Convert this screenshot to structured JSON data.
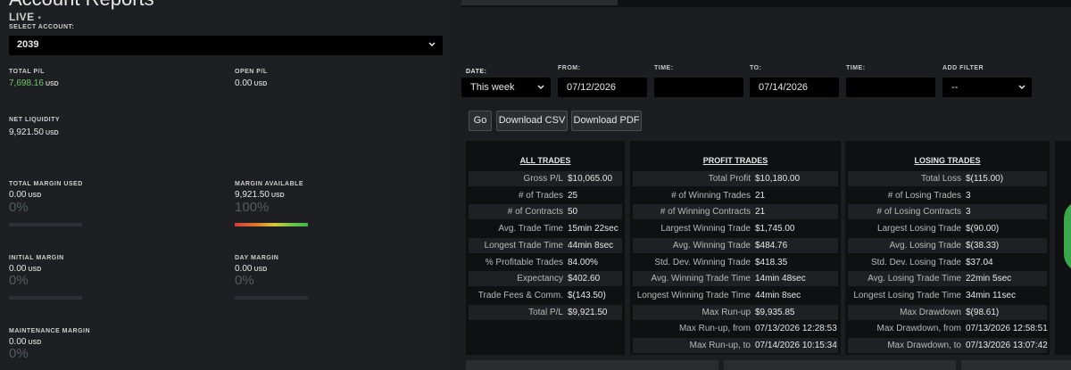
{
  "page": {
    "title": "Account Reports",
    "live_label": "LIVE",
    "live_dot": "•"
  },
  "account": {
    "select_label": "SELECT ACCOUNT:",
    "selected": "2039"
  },
  "metrics": {
    "total_pl": {
      "label": "TOTAL P/L",
      "value": "7,698.16",
      "unit": "USD"
    },
    "open_pl": {
      "label": "OPEN P/L",
      "value": "0.00",
      "unit": "USD"
    },
    "net_liquidity": {
      "label": "NET LIQUIDITY",
      "value": "9,921.50",
      "unit": "USD"
    },
    "total_margin_used": {
      "label": "TOTAL MARGIN USED",
      "value": "0.00",
      "unit": "USD",
      "pct": "0%",
      "fill": 0
    },
    "margin_available": {
      "label": "MARGIN AVAILABLE",
      "value": "9,921.50",
      "unit": "USD",
      "pct": "100%",
      "fill": 1
    },
    "initial_margin": {
      "label": "INITIAL MARGIN",
      "value": "0.00",
      "unit": "USD",
      "pct": "0%",
      "fill": 0
    },
    "day_margin": {
      "label": "DAY MARGIN",
      "value": "0.00",
      "unit": "USD",
      "pct": "0%",
      "fill": 0
    },
    "maintenance_margin": {
      "label": "MAINTENANCE MARGIN",
      "value": "0.00",
      "unit": "USD",
      "pct": "0%",
      "fill": 0
    }
  },
  "filters": {
    "date_label": "DATE:",
    "date_value": "This week",
    "from_label": "FROM:",
    "from_value": "07/12/2026",
    "time_label": "TIME:",
    "time_from_value": "",
    "to_label": "TO:",
    "to_value": "07/14/2026",
    "time2_label": "TIME:",
    "time_to_value": "",
    "add_filter_label": "ADD FILTER",
    "add_filter_value": "--"
  },
  "buttons": {
    "go": "Go",
    "download_csv": "Download CSV",
    "download_pdf": "Download PDF"
  },
  "all_trades": {
    "title": "ALL TRADES",
    "rows": [
      {
        "k": "Gross P/L",
        "v": "$10,065.00"
      },
      {
        "k": "# of Trades",
        "v": "25"
      },
      {
        "k": "# of Contracts",
        "v": "50"
      },
      {
        "k": "Avg. Trade Time",
        "v": "15min 22sec"
      },
      {
        "k": "Longest Trade Time",
        "v": "44min 8sec"
      },
      {
        "k": "% Profitable Trades",
        "v": "84.00%"
      },
      {
        "k": "Expectancy",
        "v": "$402.60"
      },
      {
        "k": "Trade Fees & Comm.",
        "v": "$(143.50)"
      },
      {
        "k": "Total P/L",
        "v": "$9,921.50"
      }
    ]
  },
  "profit_trades": {
    "title": "PROFIT TRADES",
    "rows": [
      {
        "k": "Total Profit",
        "v": "$10,180.00"
      },
      {
        "k": "# of Winning Trades",
        "v": "21"
      },
      {
        "k": "# of Winning Contracts",
        "v": "21"
      },
      {
        "k": "Largest Winning Trade",
        "v": "$1,745.00"
      },
      {
        "k": "Avg. Winning Trade",
        "v": "$484.76"
      },
      {
        "k": "Std. Dev. Winning Trade",
        "v": "$418.35"
      },
      {
        "k": "Avg. Winning Trade Time",
        "v": "14min 48sec"
      },
      {
        "k": "Longest Winning Trade Time",
        "v": "44min 8sec"
      },
      {
        "k": "Max Run-up",
        "v": "$9,935.85"
      },
      {
        "k": "Max Run-up, from",
        "v": "07/13/2026 12:28:53"
      },
      {
        "k": "Max Run-up, to",
        "v": "07/14/2026 10:15:34"
      }
    ]
  },
  "losing_trades": {
    "title": "LOSING TRADES",
    "rows": [
      {
        "k": "Total Loss",
        "v": "$(115.00)"
      },
      {
        "k": "# of Losing Trades",
        "v": "3"
      },
      {
        "k": "# of Losing Contracts",
        "v": "3"
      },
      {
        "k": "Largest Losing Trade",
        "v": "$(90.00)"
      },
      {
        "k": "Avg. Losing Trade",
        "v": "$(38.33)"
      },
      {
        "k": "Std. Dev. Losing Trade",
        "v": "$37.04"
      },
      {
        "k": "Avg. Losing Trade Time",
        "v": "22min 5sec"
      },
      {
        "k": "Longest Losing Trade Time",
        "v": "34min 11sec"
      },
      {
        "k": "Max Drawdown",
        "v": "$(98.61)"
      },
      {
        "k": "Max Drawdown, from",
        "v": "07/13/2026 12:58:51"
      },
      {
        "k": "Max Drawdown, to",
        "v": "07/13/2026 13:07:42"
      }
    ]
  },
  "colors": {
    "positive": "#6ec36e",
    "panel_bg": "#0f1012",
    "row_alt": "#1f2024",
    "accent_green": "#3aa84a"
  }
}
